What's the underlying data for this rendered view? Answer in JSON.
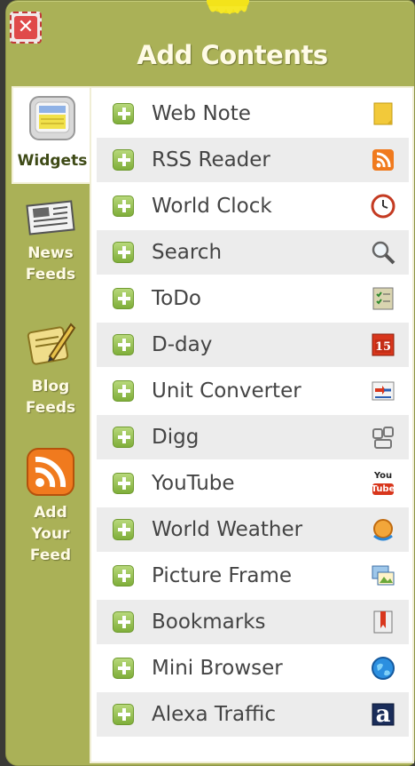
{
  "dialog": {
    "title": "Add Contents"
  },
  "tabs": [
    {
      "label": "Widgets",
      "icon": "widgets-icon"
    },
    {
      "label": "News\nFeeds",
      "icon": "newspaper-icon"
    },
    {
      "label": "Blog\nFeeds",
      "icon": "blog-pen-icon"
    },
    {
      "label": "Add\nYour\nFeed",
      "icon": "rss-feed-icon"
    }
  ],
  "widgets": [
    {
      "label": "Web Note",
      "icon": "sticky-note-icon"
    },
    {
      "label": "RSS Reader",
      "icon": "rss-icon"
    },
    {
      "label": "World Clock",
      "icon": "clock-icon"
    },
    {
      "label": "Search",
      "icon": "magnifier-icon"
    },
    {
      "label": "ToDo",
      "icon": "checklist-icon"
    },
    {
      "label": "D-day",
      "icon": "calendar-icon",
      "badge": "15"
    },
    {
      "label": "Unit Converter",
      "icon": "convert-arrows-icon"
    },
    {
      "label": "Digg",
      "icon": "digg-icon"
    },
    {
      "label": "YouTube",
      "icon": "youtube-icon",
      "badge_top": "You",
      "badge_bottom": "Tube"
    },
    {
      "label": "World Weather",
      "icon": "weather-globe-icon"
    },
    {
      "label": "Picture Frame",
      "icon": "picture-frame-icon"
    },
    {
      "label": "Bookmarks",
      "icon": "bookmark-icon"
    },
    {
      "label": "Mini Browser",
      "icon": "globe-icon"
    },
    {
      "label": "Alexa Traffic",
      "icon": "alexa-icon",
      "badge": "a"
    }
  ]
}
